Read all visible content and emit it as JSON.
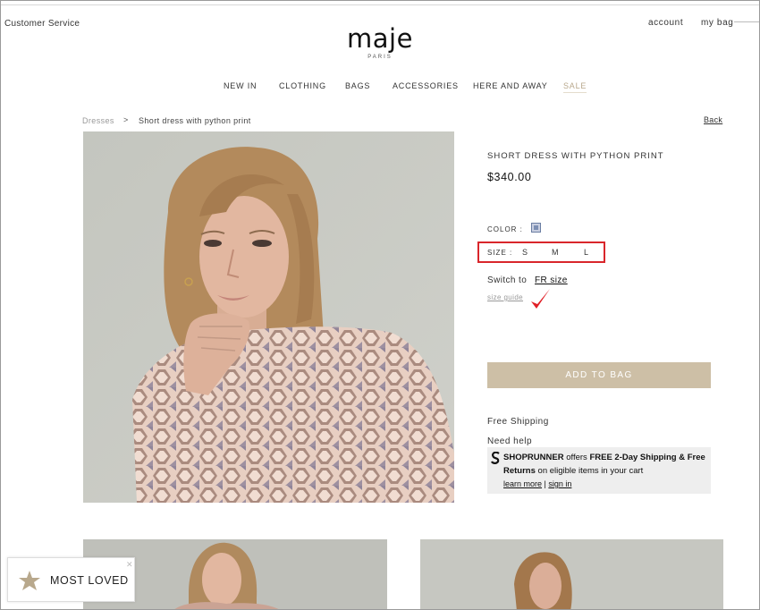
{
  "header": {
    "customer_service": "Customer Service",
    "account": "account",
    "bag": "my bag",
    "logo": "maje",
    "logo_sub": "PARIS"
  },
  "nav": {
    "items": [
      "NEW IN",
      "CLOTHING",
      "BAGS",
      "ACCESSORIES",
      "HERE AND AWAY",
      "SALE"
    ]
  },
  "breadcrumb": {
    "parent": "Dresses",
    "separator": ">",
    "current": "Short dress with python print",
    "back": "Back"
  },
  "product": {
    "title": "SHORT DRESS WITH PYTHON PRINT",
    "price": "$340.00",
    "color_label": "COLOR :",
    "size_label": "SIZE :",
    "sizes": [
      "S",
      "M",
      "L"
    ],
    "switch_text": "Switch to",
    "switch_link": "FR size",
    "size_guide": "size guide",
    "add_to_bag": "ADD TO BAG",
    "free_shipping": "Free Shipping",
    "need_help": "Need help"
  },
  "shoprunner": {
    "brand": "SHOPRUNNER",
    "offers": " offers ",
    "free": "FREE 2-Day Shipping & Free",
    "returns": "Returns",
    "eligible": " on eligible items in your cart",
    "learn_more": "learn more",
    "divider": " | ",
    "sign_in": "sign in"
  },
  "badge": {
    "most_loved": "MOST LOVED",
    "close": "✕"
  },
  "colors": {
    "accent_beige": "#cdbfa6",
    "highlight_red": "#d9262b",
    "sale": "#b8a88c"
  }
}
